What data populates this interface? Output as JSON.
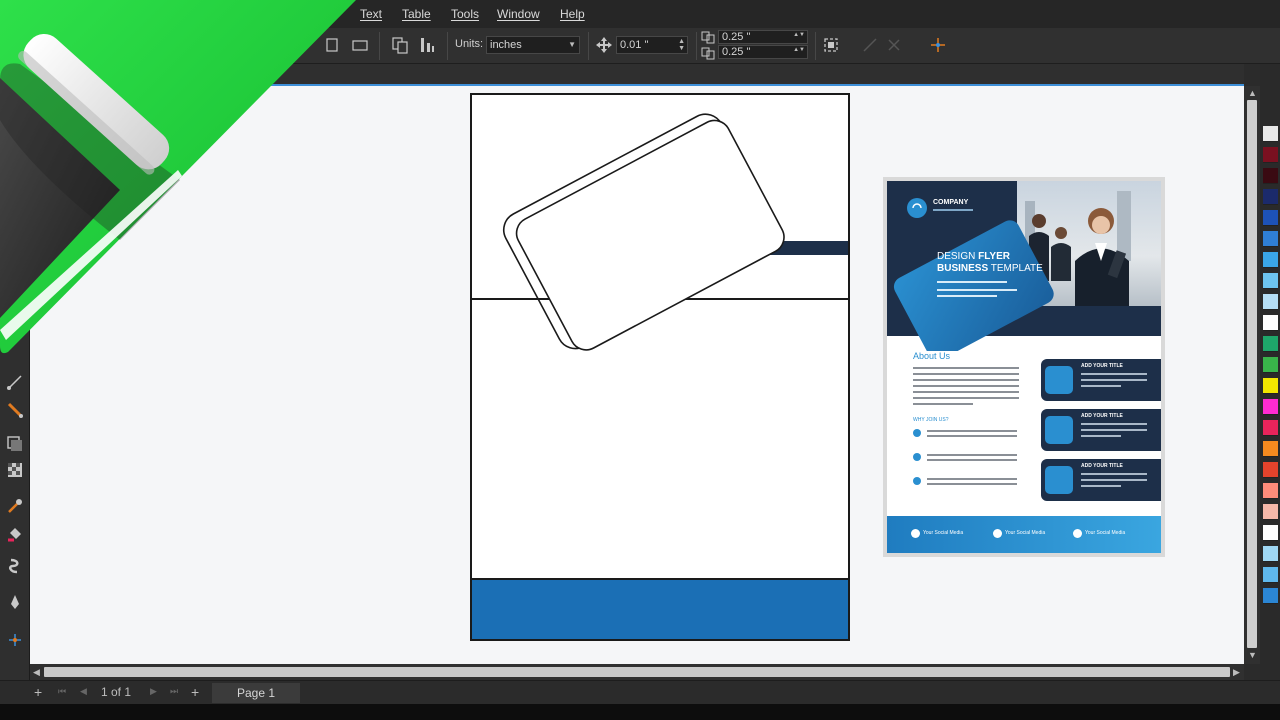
{
  "menu": {
    "items": [
      {
        "label": "Text"
      },
      {
        "label": "Table"
      },
      {
        "label": "Tools"
      },
      {
        "label": "Window"
      },
      {
        "label": "Help"
      }
    ]
  },
  "property_bar": {
    "units_label": "Units:",
    "units_value": "inches",
    "nudge_value": "0.01 \"",
    "dup_x": "0.25 \"",
    "dup_y": "0.25 \""
  },
  "status": {
    "page_counter": "1 of 1",
    "page_tab": "Page 1"
  },
  "flyer": {
    "company": "COMPANY",
    "headline_line1_light": "DESIGN",
    "headline_line1_bold": "FLYER",
    "headline_line2_bold": "BUSINESS",
    "headline_line2_light": "TEMPLATE",
    "about_title": "About Us",
    "why_title": "WHY JOIN US?",
    "cards": [
      {
        "title": "ADD YOUR TITLE"
      },
      {
        "title": "ADD YOUR TITLE"
      },
      {
        "title": "ADD YOUR TITLE"
      }
    ],
    "social": [
      {
        "label": "Your Social Media"
      },
      {
        "label": "Your Social Media"
      },
      {
        "label": "Your Social Media"
      }
    ]
  },
  "colors": {
    "accent_green": "#22c93c",
    "page_band_blue": "#1b6fb5",
    "flyer_navy": "#1d2f49",
    "flyer_blue": "#2a8fd0",
    "selection_line": "#3d8fd8"
  },
  "palette": [
    "#e8e8e8",
    "#7a1020",
    "#3a0a12",
    "#1b2a6b",
    "#1d52b8",
    "#2f7fd6",
    "#3aa6e8",
    "#6dc4f0",
    "#b5def5",
    "#ffffff",
    "#1ea66a",
    "#39b54a",
    "#f2e600",
    "#ff2bd1",
    "#e8245b",
    "#f58a1f",
    "#e4432c",
    "#ff8c7a",
    "#f5b7a8",
    "#ffffff",
    "#9fd7f3",
    "#5fb8ec",
    "#2b86d4"
  ]
}
